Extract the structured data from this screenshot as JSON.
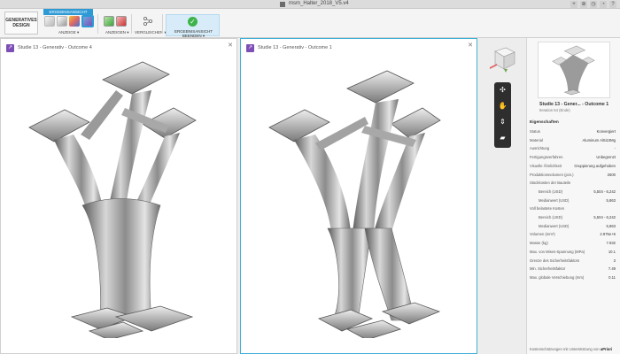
{
  "window": {
    "title": "msm_Halter_2018_V5.v4"
  },
  "ribbon": {
    "workspace_line1": "GENERATIVES",
    "workspace_line2": "DESIGN",
    "active_tab": "ERGEBNISANSICHT",
    "groups": {
      "anzeige": "ANZEIGE ▾",
      "anzeigen": "ANZEIGEN ▾",
      "vergleichen": "VERGLEICHEN ▾"
    },
    "finish_button": "ERGEBNISANSICHT BEENDEN ▾"
  },
  "panes": [
    {
      "title": "Studie 13 - Generativ - Outcome 4"
    },
    {
      "title": "Studie 13 - Generativ - Outcome 1"
    }
  ],
  "properties": {
    "title": "Studie 13 - Gener... - Outcome 1",
    "subtitle": "Iteration 54 (Ende)",
    "heading": "Eigenschaften",
    "rows": [
      {
        "k": "Status",
        "v": "Konvergiert",
        "indent": false
      },
      {
        "k": "Material",
        "v": "Aluminum AlSi10Mg",
        "indent": false
      },
      {
        "k": "Ausrichtung",
        "v": "-",
        "indent": false
      },
      {
        "k": "Fertigungsverfahren",
        "v": "Unbegrenzt",
        "indent": false
      },
      {
        "k": "Visuelle Ähnlichkeit",
        "v": "Gruppierung aufgehoben",
        "indent": false
      },
      {
        "k": "Produktionsvolumen (pcs.)",
        "v": "2500",
        "indent": false
      },
      {
        "k": "Stückkosten der Bauteile",
        "v": "",
        "indent": false
      },
      {
        "k": "Bereich (USD)",
        "v": "5,504 - 6,242",
        "indent": true
      },
      {
        "k": "Medianwert (USD)",
        "v": "5,863",
        "indent": true
      },
      {
        "k": "Voll belastete Kosten",
        "v": "",
        "indent": false
      },
      {
        "k": "Bereich (USD)",
        "v": "5,504 - 6,242",
        "indent": true
      },
      {
        "k": "Medianwert (USD)",
        "v": "5,863",
        "indent": true
      },
      {
        "k": "Volumen (mm³)",
        "v": "2.975e+6",
        "indent": false
      },
      {
        "k": "Masse (kg)",
        "v": "7.932",
        "indent": false
      },
      {
        "k": "Max. von Mises-Spannung (MPa)",
        "v": "10.1",
        "indent": false
      },
      {
        "k": "Grenze des Sicherheitsfaktors",
        "v": "3",
        "indent": false
      },
      {
        "k": "Min. Sicherheitsfaktor",
        "v": "7.49",
        "indent": false
      },
      {
        "k": "Max. globale Verschiebung (mm)",
        "v": "0.11",
        "indent": false
      }
    ],
    "footer_text": "Kostenschätzungen mit Unterstützung von",
    "footer_brand": "aPriori"
  },
  "colors": {
    "accent": "#2d9ad6",
    "pane_icon": "#7d4fb6",
    "success": "#3db34a",
    "active_border": "#3fb1d6"
  }
}
